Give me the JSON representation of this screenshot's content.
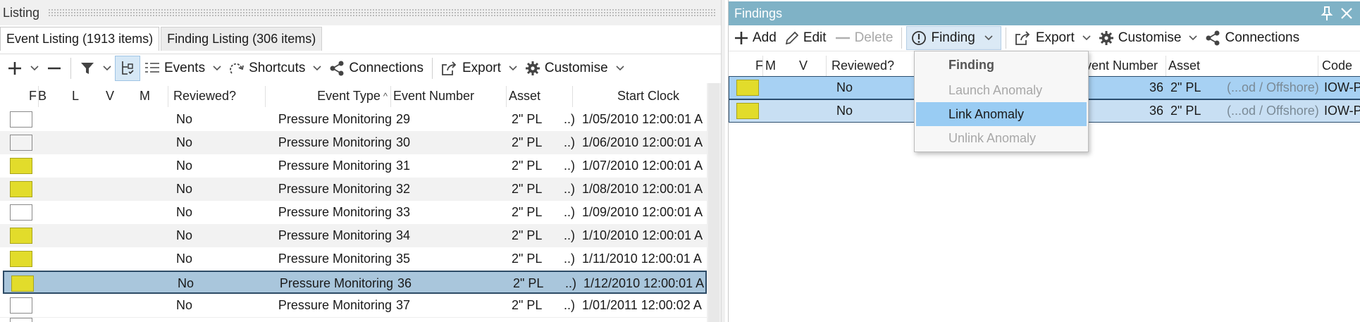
{
  "listing": {
    "title": "Listing",
    "tabs": [
      {
        "label": "Event Listing (1913 items)",
        "active": true
      },
      {
        "label": "Finding Listing (306 items)",
        "active": false
      }
    ],
    "toolbar": {
      "add_icon": "plus-icon",
      "remove_icon": "minus-icon",
      "filter_icon": "filter-icon",
      "hierarchy_icon": "hierarchy-icon",
      "events_label": "Events",
      "shortcuts_label": "Shortcuts",
      "connections_label": "Connections",
      "export_label": "Export",
      "customise_label": "Customise"
    },
    "columns": {
      "f": "F",
      "b": "B",
      "l": "L",
      "v": "V",
      "m": "M",
      "reviewed": "Reviewed?",
      "event_type": "Event Type",
      "event_number": "Event Number",
      "asset": "Asset",
      "start_clock": "Start Clock",
      "sort_indicator": "^"
    },
    "rows": [
      {
        "flag": "white",
        "reviewed": "No",
        "event_type": "Pressure Monitoring",
        "event_number": "29",
        "asset": "2\" PL",
        "asset_more": "..)",
        "start_clock": "1/05/2010 12:00:01 A"
      },
      {
        "flag": "grey",
        "reviewed": "No",
        "event_type": "Pressure Monitoring",
        "event_number": "30",
        "asset": "2\" PL",
        "asset_more": "..)",
        "start_clock": "1/06/2010 12:00:01 A"
      },
      {
        "flag": "yellow",
        "reviewed": "No",
        "event_type": "Pressure Monitoring",
        "event_number": "31",
        "asset": "2\" PL",
        "asset_more": "..)",
        "start_clock": "1/07/2010 12:00:01 A"
      },
      {
        "flag": "yellow",
        "reviewed": "No",
        "event_type": "Pressure Monitoring",
        "event_number": "32",
        "asset": "2\" PL",
        "asset_more": "..)",
        "start_clock": "1/08/2010 12:00:01 A"
      },
      {
        "flag": "white",
        "reviewed": "No",
        "event_type": "Pressure Monitoring",
        "event_number": "33",
        "asset": "2\" PL",
        "asset_more": "..)",
        "start_clock": "1/09/2010 12:00:01 A"
      },
      {
        "flag": "yellow",
        "reviewed": "No",
        "event_type": "Pressure Monitoring",
        "event_number": "34",
        "asset": "2\" PL",
        "asset_more": "..)",
        "start_clock": "1/10/2010 12:00:01 A"
      },
      {
        "flag": "yellow",
        "reviewed": "No",
        "event_type": "Pressure Monitoring",
        "event_number": "35",
        "asset": "2\" PL",
        "asset_more": "..)",
        "start_clock": "1/11/2010 12:00:01 A"
      },
      {
        "flag": "yellow",
        "reviewed": "No",
        "event_type": "Pressure Monitoring",
        "event_number": "36",
        "asset": "2\" PL",
        "asset_more": "..)",
        "start_clock": "1/12/2010 12:00:01 A",
        "selected": true
      },
      {
        "flag": "white",
        "reviewed": "No",
        "event_type": "Pressure Monitoring",
        "event_number": "37",
        "asset": "2\" PL",
        "asset_more": "..)",
        "start_clock": "1/01/2011 12:00:02 A"
      }
    ]
  },
  "findings": {
    "title": "Findings",
    "pin_icon": "pin-icon",
    "close_icon": "close-icon",
    "toolbar": {
      "add_label": "Add",
      "edit_label": "Edit",
      "delete_label": "Delete",
      "finding_label": "Finding",
      "export_label": "Export",
      "customise_label": "Customise",
      "connections_label": "Connections"
    },
    "columns": {
      "f": "F",
      "m": "M",
      "v": "V",
      "reviewed": "Reviewed?",
      "event_number": "Event Number",
      "asset": "Asset",
      "code": "Code",
      "event_number_clipped": "vent Number"
    },
    "rows": [
      {
        "flag": "yellow",
        "reviewed": "No",
        "event_number": "36",
        "asset": "2\" PL",
        "asset_path": "(...od / Offshore)",
        "code": "IOW-P"
      },
      {
        "flag": "yellow",
        "reviewed": "No",
        "event_number": "36",
        "asset": "2\" PL",
        "asset_path": "(...od / Offshore)",
        "code": "IOW-P"
      }
    ],
    "menu": {
      "header": "Finding",
      "items": [
        {
          "label": "Launch Anomaly",
          "enabled": false
        },
        {
          "label": "Link Anomaly",
          "enabled": true,
          "hovered": true
        },
        {
          "label": "Unlink Anomaly",
          "enabled": false
        }
      ]
    }
  }
}
